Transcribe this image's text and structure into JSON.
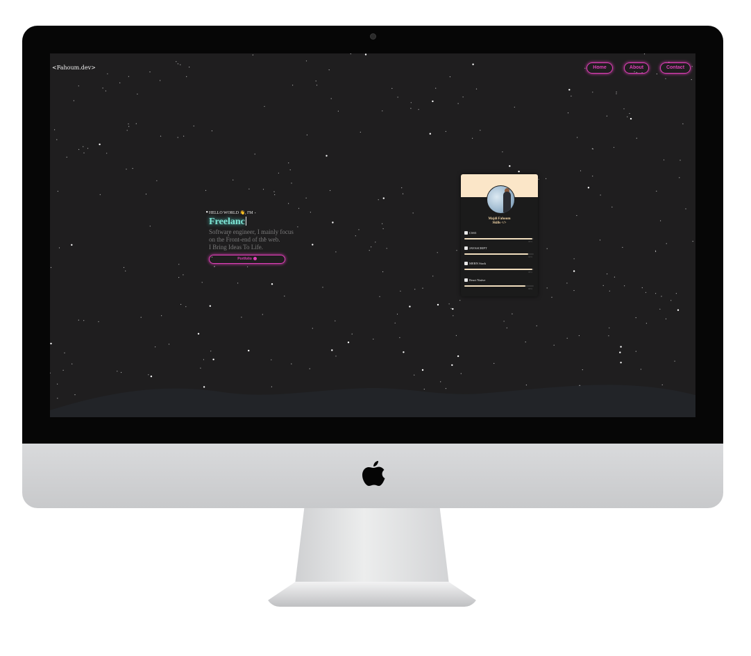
{
  "site": {
    "logo": "<Fahoum.dev>",
    "nav": [
      {
        "label": "Home"
      },
      {
        "label": "About"
      },
      {
        "label": "Contact"
      }
    ]
  },
  "hero": {
    "greeting": "HELLO WORLD",
    "greeting_emoji": "👋",
    "greeting_suffix": ", I'M",
    "typed_text": "Freelanc",
    "description_line1": "Software engineer, I mainly focus",
    "description_line2": "on the Front-end of the web.",
    "description_line3": "I Bring Ideas To Life.",
    "cta_label": "Portfolio"
  },
  "card": {
    "name": "Majdi Fahoum",
    "subtitle": "Skills </>",
    "skills": [
      {
        "label": "CSS3",
        "icon": "css-shield-icon",
        "level": 0.98,
        "pct": "98%"
      },
      {
        "label": "JAVASCRIPT",
        "icon": "javascript-icon",
        "level": 0.92,
        "pct": "92%"
      },
      {
        "label": "MERN Stack",
        "icon": "layers-icon",
        "level": 0.98,
        "pct": "98%"
      },
      {
        "label": "React Native",
        "icon": "react-icon",
        "level": 0.88,
        "pct": "88%"
      }
    ]
  },
  "colors": {
    "neon_pink": "#e03fb8",
    "teal": "#7ee3d3",
    "card_accent": "#fbe6c8",
    "screen_bg": "#1f1e1f"
  }
}
